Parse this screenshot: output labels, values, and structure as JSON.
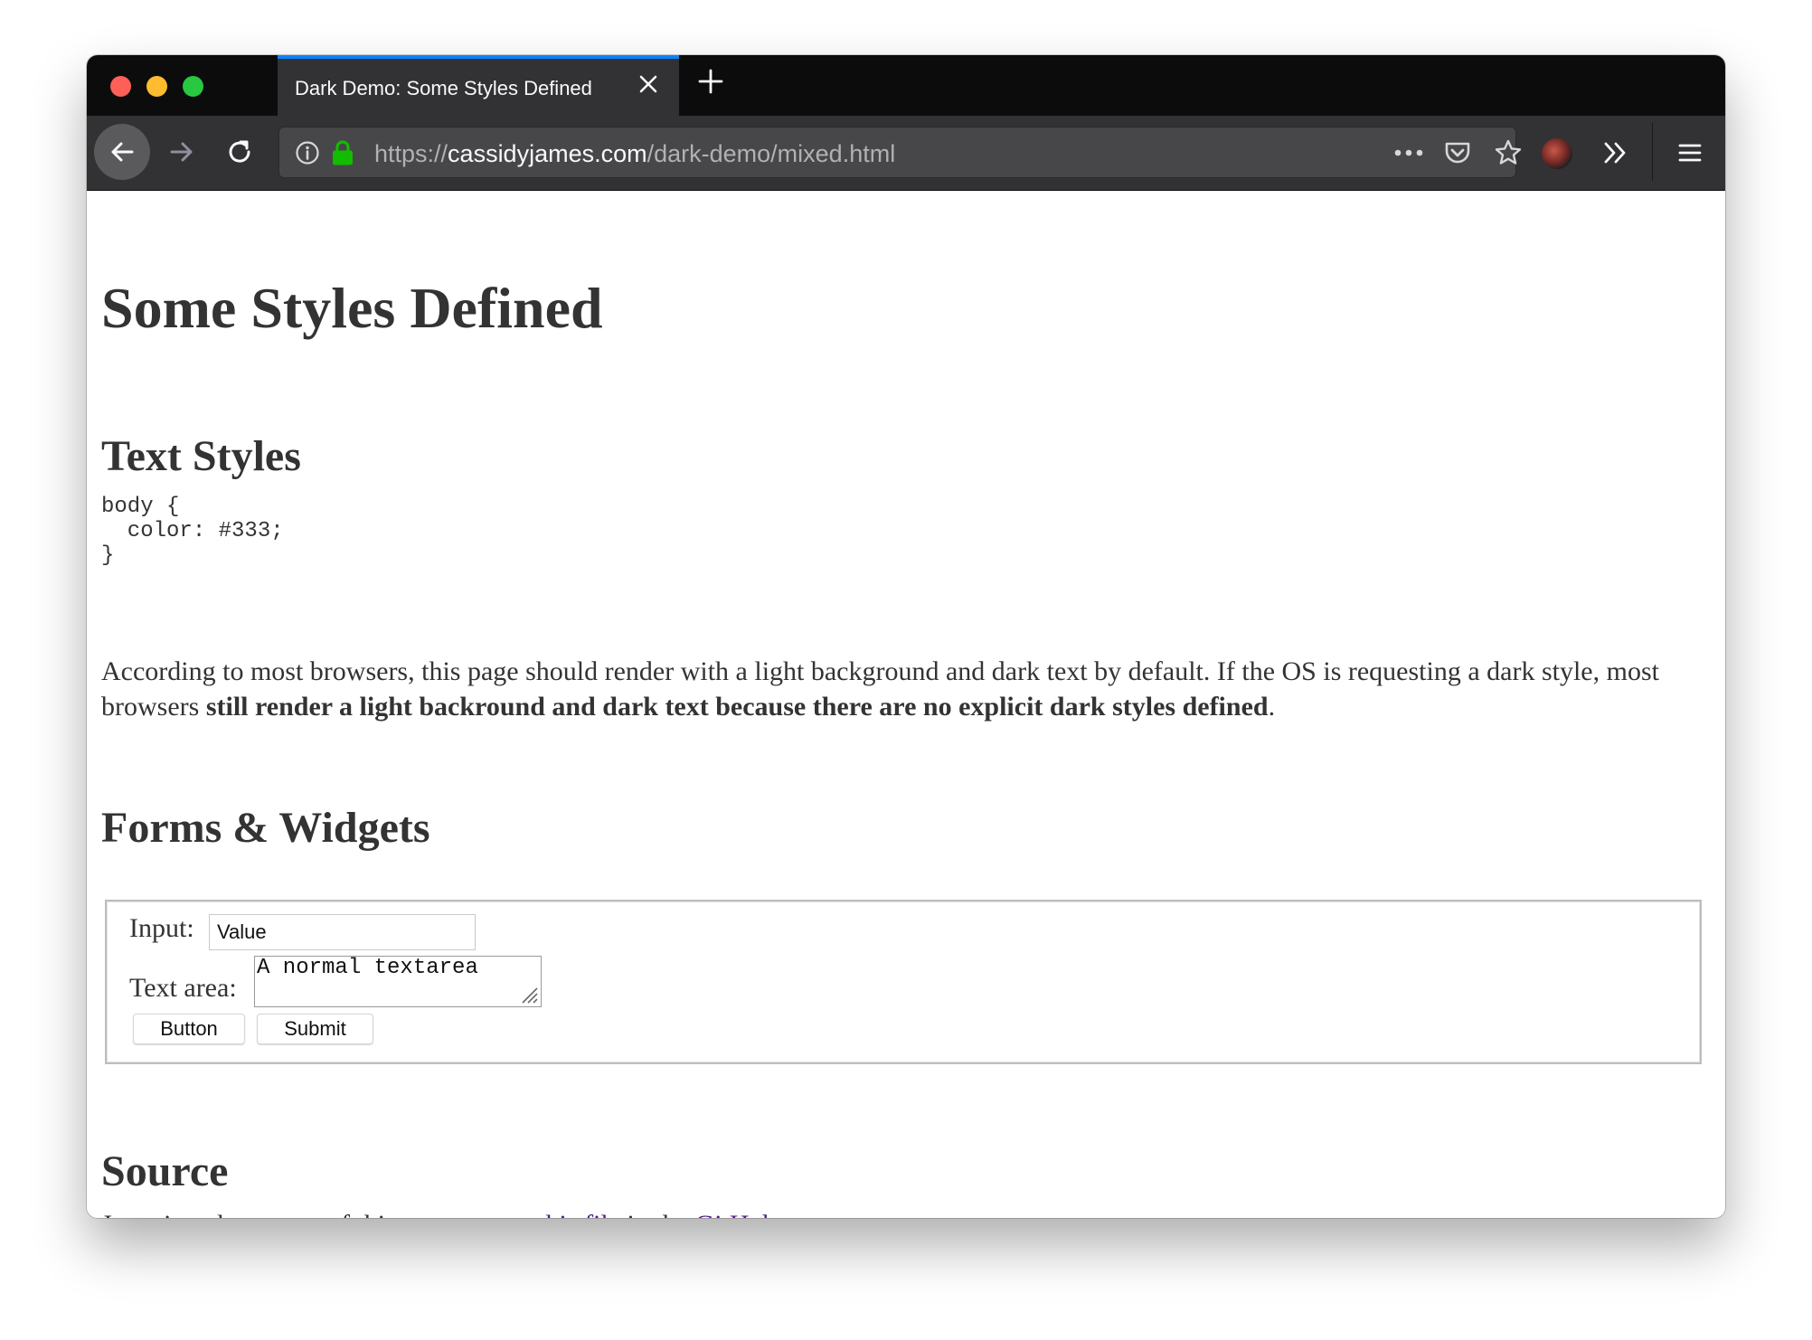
{
  "browser": {
    "tab": {
      "title": "Dark Demo: Some Styles Defined"
    },
    "url": {
      "scheme": "https://",
      "host": "cassidyjames.com",
      "path": "/dark-demo/mixed.html"
    }
  },
  "page": {
    "title": "Some Styles Defined",
    "text_styles": {
      "heading": "Text Styles",
      "code": "body {\n  color: #333;\n}",
      "paragraph_normal": "According to most browsers, this page should render with a light background and dark text by default. If the OS is requesting a dark style, most browsers ",
      "paragraph_bold": "still render a light backround and dark text because there are no explicit dark styles defined",
      "paragraph_end": "."
    },
    "forms": {
      "heading": "Forms & Widgets",
      "input_label": "Input:",
      "input_value": "Value",
      "textarea_label": "Text area:",
      "textarea_value": "A normal textarea",
      "button_label": "Button",
      "submit_label": "Submit"
    },
    "source": {
      "heading": "Source",
      "text_before": "Just view the source of this page, or see ",
      "link_file": "this file",
      "text_middle": " in the ",
      "link_repo": "GitHub repo",
      "text_end": "."
    }
  },
  "icons": [
    "back-arrow-icon",
    "forward-arrow-icon",
    "reload-icon",
    "info-icon",
    "lock-icon",
    "more-dots-icon",
    "pocket-icon",
    "bookmark-star-icon",
    "overflow-chevron-icon",
    "hamburger-menu-icon",
    "close-icon",
    "plus-icon"
  ],
  "colors": {
    "tab_accent": "#0a84ff",
    "lock_green": "#12bc00",
    "text": "#333333",
    "link_visited": "#551a8b"
  }
}
